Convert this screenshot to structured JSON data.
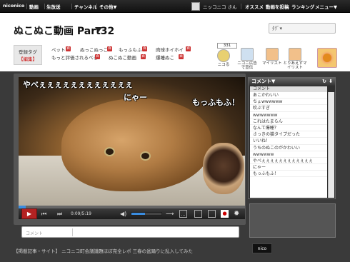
{
  "nav": {
    "items": [
      "niconico",
      "動画",
      "生放送",
      "チャンネル",
      "その他▼"
    ],
    "user": "ニッコニコ さん",
    "right": [
      "オススメ",
      "動画を投稿",
      "ランキング",
      "メニュー▼"
    ]
  },
  "page": {
    "title": "ぬこぬこ動画 Part32",
    "search_placeholder": "ﾀｸﾞ▾"
  },
  "tags": {
    "button_l1": "登録タグ",
    "button_l2": "【編集】",
    "items": [
      "ペット",
      "ぬっこぬっこ",
      "もっふもふ",
      "肉球ホイホイ",
      "もっと評価されるべき",
      "ぬこぬこ動画",
      "爆睡ぬこ"
    ]
  },
  "tools": {
    "count": "331",
    "items": [
      "ニコる",
      "ニコニ広告で宣伝",
      "マイリスト",
      "とりあえずマイリスト"
    ]
  },
  "video": {
    "overlays": [
      "やべぇぇぇぇぇぇぇぇぇぇぇぇ",
      "にゃー",
      "もっふもふ！"
    ],
    "time": "0:09/5:19",
    "progress": 0.03,
    "volume": 0.45
  },
  "comments": {
    "header": "コメント▼",
    "column": "コメント",
    "rows": [
      "あこかわいい",
      "ちょwwwwww",
      "吹ぶすぎ",
      "wwwwwww",
      "これはたまらん",
      "なんて爆睡？",
      "さっきの猫タイプだった",
      "いいね！",
      "うちのぬこのがかわいい",
      "wwwwww",
      "やべぇぇぇぇぇぇぇぇぇぇぇぇ",
      "にゃー",
      "もっふもふ！"
    ]
  },
  "input": {
    "label": "コメント"
  },
  "footer": {
    "text": "【掲載記事・サイト】 ニコニコ町会議議題ほぼ完全レポ 三春の盆踊りに乱入してみた"
  }
}
